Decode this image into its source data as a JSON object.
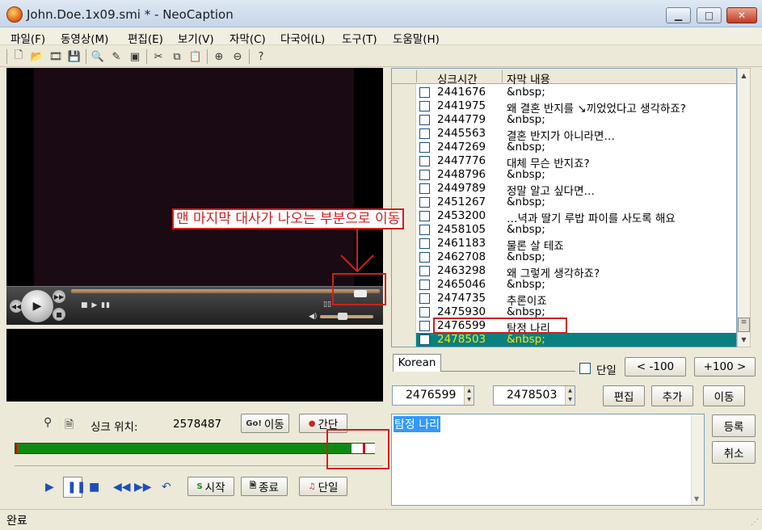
{
  "window": {
    "title": "John.Doe.1x09.smi * - NeoCaption",
    "minimize": "▁",
    "maximize": "□",
    "close": "✕"
  },
  "menu": [
    "파일(F)",
    "동영상(M)",
    "편집(E)",
    "보기(V)",
    "자막(C)",
    "다국어(L)",
    "도구(T)",
    "도움말(H)"
  ],
  "toolbar_icons": [
    "new-file-icon",
    "open-folder-icon",
    "open-video-icon",
    "save-icon",
    "print-preview-icon",
    "edit-icon",
    "window-icon",
    "cut-icon",
    "copy-icon",
    "paste-icon",
    "zoom-in-icon",
    "zoom-out-icon",
    "help-icon"
  ],
  "player": {
    "play_icon": "▶",
    "controls_text": "■ ▶ ▮▮",
    "right_text": "▯▯",
    "volume_icon": "◀)"
  },
  "sync": {
    "label": "싱크 위치:",
    "value": "2578487",
    "go_button_icon": "Go!",
    "go_button": "이동",
    "interval_button": "간단"
  },
  "playback": {
    "start_button": "시작",
    "end_button": "종료",
    "single_button": "단일"
  },
  "list": {
    "col_time": "싱크시간",
    "col_text": "자막 내용",
    "rows": [
      {
        "time": "2441676",
        "text": "&nbsp;"
      },
      {
        "time": "2441975",
        "text": "왜 결혼 반지를 ↘끼었었다고 생각하죠?"
      },
      {
        "time": "2444779",
        "text": "&nbsp;"
      },
      {
        "time": "2445563",
        "text": "결혼 반지가 아니라면…"
      },
      {
        "time": "2447269",
        "text": "&nbsp;"
      },
      {
        "time": "2447776",
        "text": "대체 무슨 반지죠?"
      },
      {
        "time": "2448796",
        "text": "&nbsp;"
      },
      {
        "time": "2449789",
        "text": "정말 알고 싶다면…"
      },
      {
        "time": "2451267",
        "text": "&nbsp;"
      },
      {
        "time": "2453200",
        "text": "…녁과 딸기 루밥 파이를 사도록 해요"
      },
      {
        "time": "2458105",
        "text": "&nbsp;"
      },
      {
        "time": "2461183",
        "text": "물론 살 테죠"
      },
      {
        "time": "2462708",
        "text": "&nbsp;"
      },
      {
        "time": "2463298",
        "text": "왜 그렇게 생각하죠?"
      },
      {
        "time": "2465046",
        "text": "&nbsp;"
      },
      {
        "time": "2474735",
        "text": "추론이죠"
      },
      {
        "time": "2475930",
        "text": "&nbsp;"
      },
      {
        "time": "2476599",
        "text": "탐정 나리"
      },
      {
        "time": "2478503",
        "text": "&nbsp;"
      }
    ]
  },
  "annotation": "맨 마지막 대사가 나오는 부분으로 이동",
  "controls": {
    "tab": "Korean",
    "single_label": "단일",
    "minus_button": "< -100",
    "plus_button": "+100 >",
    "spin1": "2476599",
    "spin2": "2478503",
    "edit_button": "편집",
    "add_button": "추가",
    "move_button": "이동",
    "edit_text": "탐정 나리",
    "register_button": "등록",
    "cancel_button": "취소"
  },
  "status": "완료"
}
